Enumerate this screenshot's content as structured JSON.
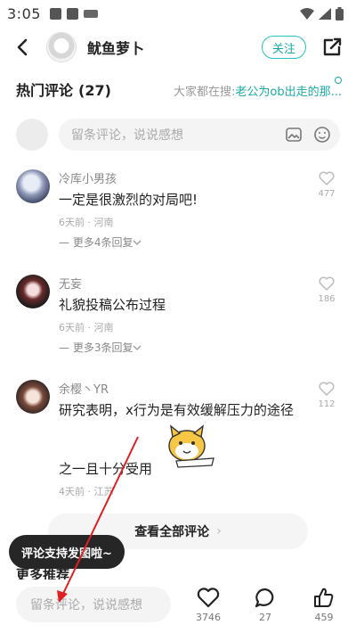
{
  "status": {
    "time": "3:05"
  },
  "header": {
    "author": "鱿鱼萝卜",
    "follow_label": "关注"
  },
  "section": {
    "title": "热门评论",
    "count": "(27)",
    "hot_prefix": "大家都在搜:",
    "hot_query": "老公为ob出走的那..."
  },
  "top_input": {
    "placeholder": "留条评论，说说感想"
  },
  "comments": [
    {
      "name": "冷库小男孩",
      "text": "一定是很激烈的对局吧!",
      "meta": "6天前 · 河南",
      "replies": "— 更多4条回复",
      "likes": "477"
    },
    {
      "name": "无妄",
      "text": "礼貌投稿公布过程",
      "meta": "6天前 · 河南",
      "replies": "— 更多3条回复",
      "likes": "186"
    },
    {
      "name": "余樱丶YR",
      "text": "研究表明，x行为是有效缓解压力的途径",
      "text2": "之一且十分受用",
      "meta": "4天前 · 江苏",
      "likes": "112"
    }
  ],
  "view_all": {
    "label": "查看全部评论"
  },
  "more_recs": {
    "title": "更多推荐"
  },
  "tooltip": {
    "text": "评论支持发图啦~"
  },
  "bottom": {
    "placeholder": "留条评论，说说感想",
    "likes": "3746",
    "comments": "27",
    "thumbs": "459"
  },
  "colors": {
    "accent": "#1ba8a8",
    "annotation_arrow": "#e02020"
  },
  "icons": [
    "back-icon",
    "share-icon",
    "image-icon",
    "emoji-icon",
    "heart-icon",
    "chat-icon",
    "thumbs-up-icon"
  ]
}
